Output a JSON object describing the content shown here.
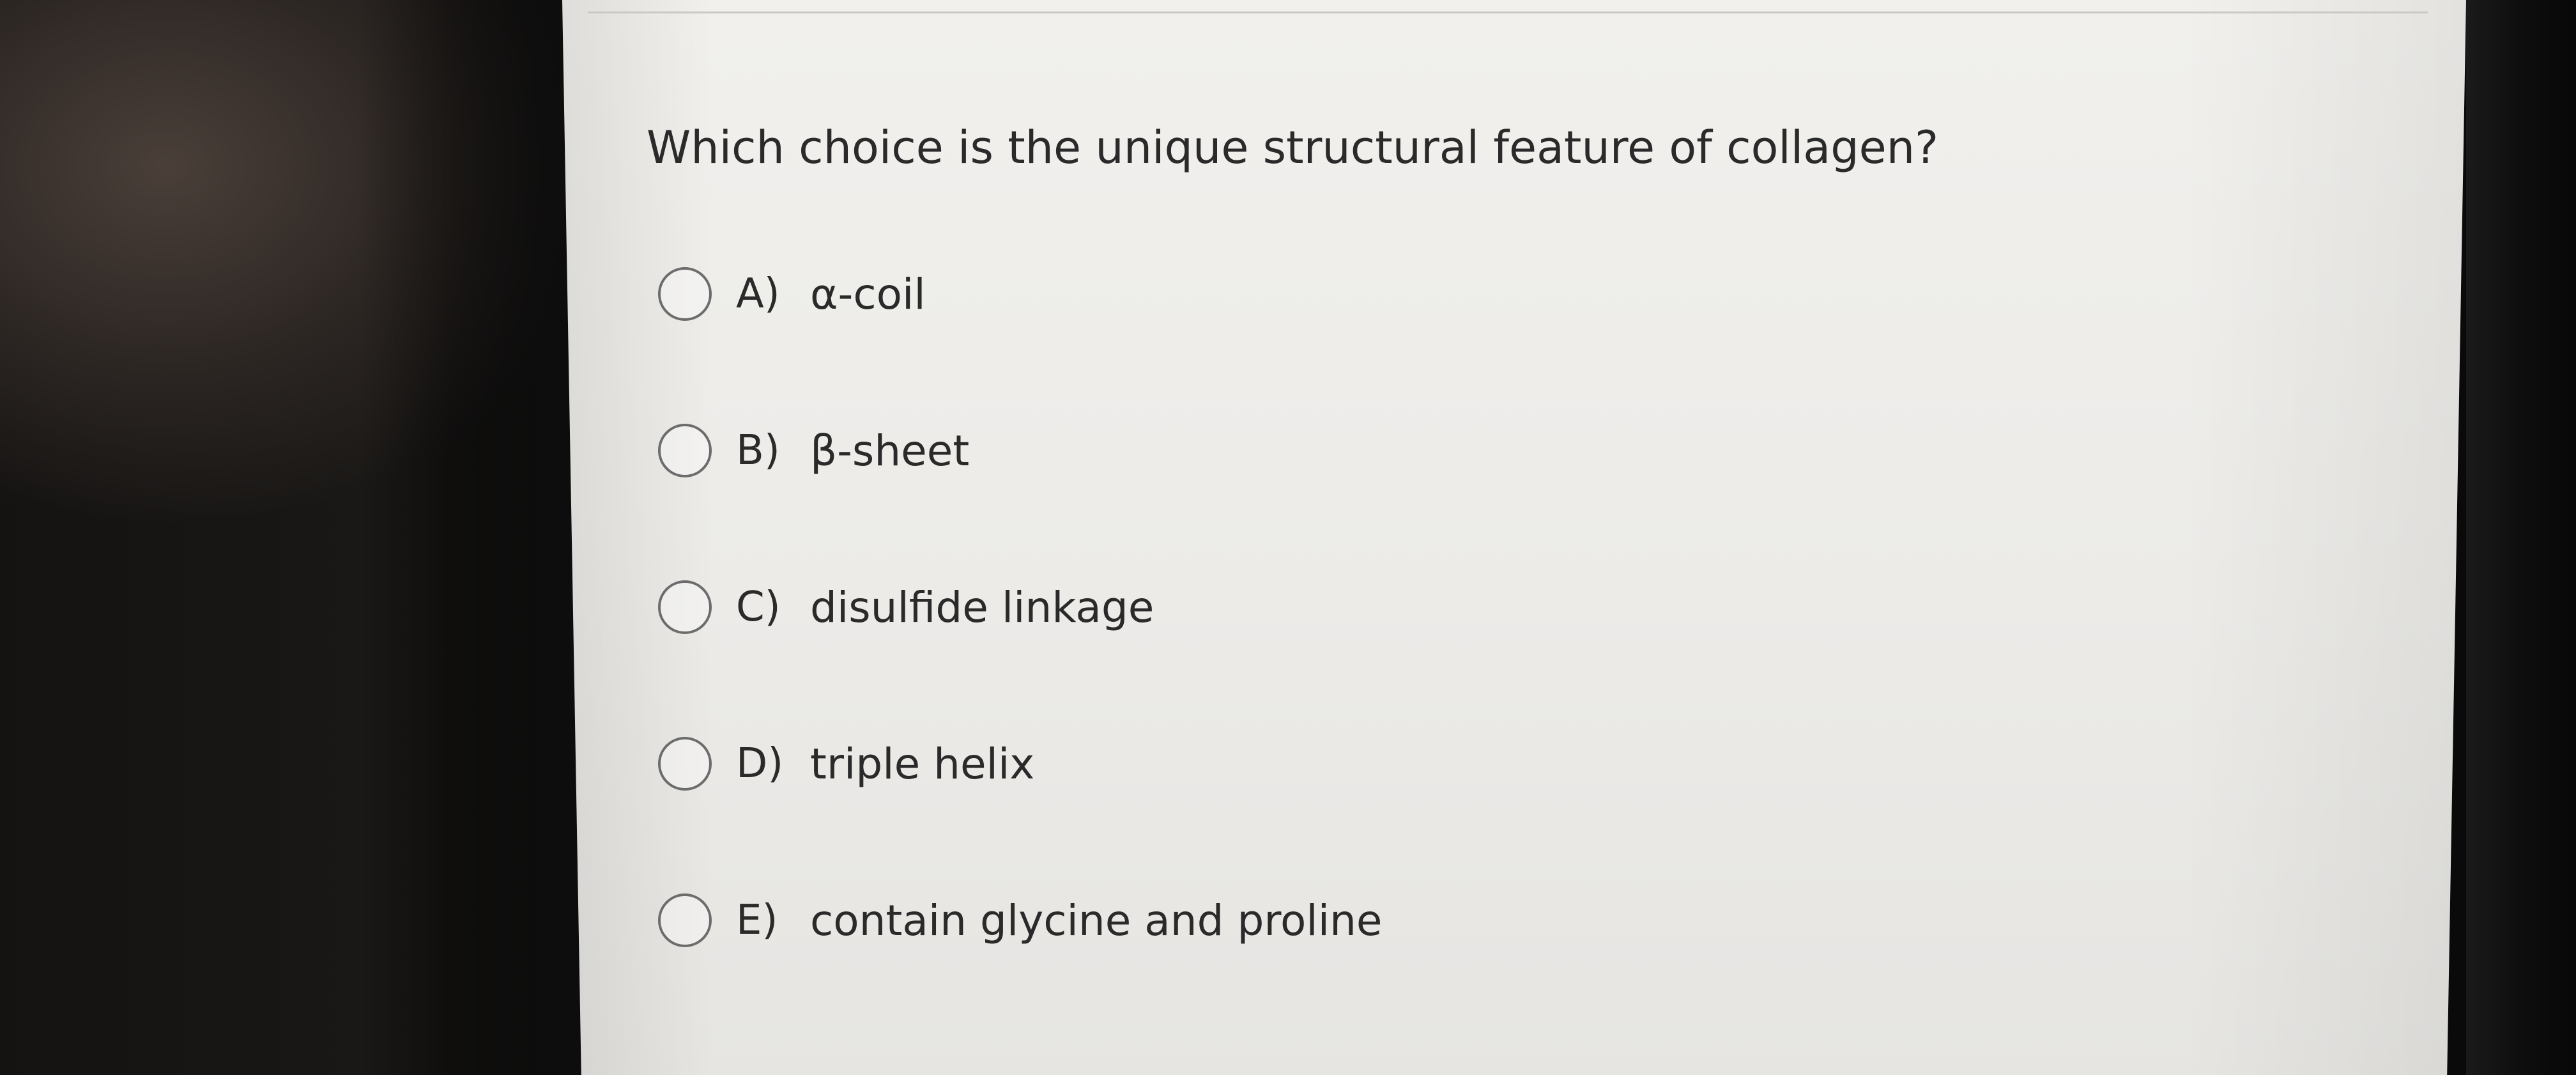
{
  "question": {
    "text": "Which choice is the unique structural feature of collagen?"
  },
  "options": [
    {
      "letter": "A)",
      "text": "α-coil"
    },
    {
      "letter": "B)",
      "text": "β-sheet"
    },
    {
      "letter": "C)",
      "text": "disulfide linkage"
    },
    {
      "letter": "D)",
      "text": "triple helix"
    },
    {
      "letter": "E)",
      "text": "contain glycine and proline"
    }
  ],
  "colors": {
    "screen_background": "#ecebe8",
    "text": "#2a2a2a",
    "radio_border": "#6c6c6c"
  },
  "icons": {
    "option_control": "radio-button-unselected"
  }
}
